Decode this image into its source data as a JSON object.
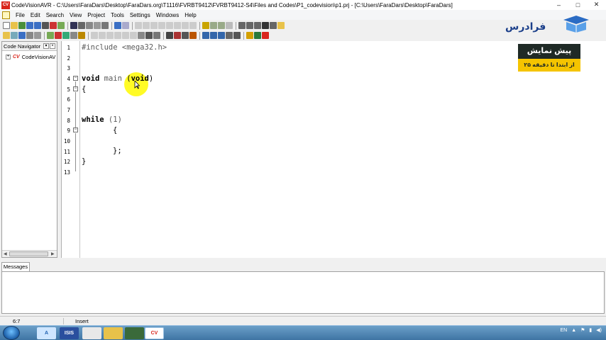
{
  "window": {
    "icon": "codevisionavr-app-icon",
    "title": "CodeVisionAVR - C:\\Users\\FaraDars\\Desktop\\FaraDars.org\\T1116\\FVRBT9412\\FVRBT9412-S4\\Files and Codes\\P1_codevision\\p1.prj - [C:\\Users\\FaraDars\\Desktop\\FaraDars]",
    "controls": {
      "minimize": "–",
      "maximize": "□",
      "close": "✕"
    }
  },
  "menu": [
    "File",
    "Edit",
    "Search",
    "View",
    "Project",
    "Tools",
    "Settings",
    "Windows",
    "Help"
  ],
  "navigator": {
    "title": "Code Navigator",
    "items": [
      {
        "label": "CodeVisionAV",
        "expander": "+",
        "icon_text": "CV"
      }
    ]
  },
  "editor": {
    "line_numbers": [
      "1",
      "2",
      "3",
      "4",
      "5",
      "6",
      "7",
      "8",
      "9",
      "10",
      "11",
      "12",
      "13"
    ],
    "code": {
      "l1": "#include <mega32.h>",
      "l4_kw1": "void",
      "l4_mid": " main ",
      "l4_paren_open": "(",
      "l4_kw2": "void",
      "l4_paren_close": ")",
      "l5": "{",
      "l8_kw": "while",
      "l8_rest": " (1)",
      "l9": "{",
      "l11": "};",
      "l12": "}"
    }
  },
  "watermark": {
    "text": "فرادرس"
  },
  "promo": {
    "title": "پیش نمایش",
    "subtitle": "از ابتدا تا دقیقه ۲۵"
  },
  "messages": {
    "tab_label": "Messages"
  },
  "status": {
    "position": "6:7",
    "mode": "Insert"
  },
  "taskbar": {
    "apps": [
      "word-app-icon",
      "isis-app-icon",
      "explorer-app-icon",
      "folder-app-icon",
      "chip-app-icon",
      "codevision-app-icon"
    ],
    "tray_lang": "EN"
  },
  "colors": {
    "accent": "#d9261c",
    "promo_dark": "#1f2a26",
    "promo_yellow": "#f5c400",
    "cursor_highlight": "#fffa00"
  }
}
